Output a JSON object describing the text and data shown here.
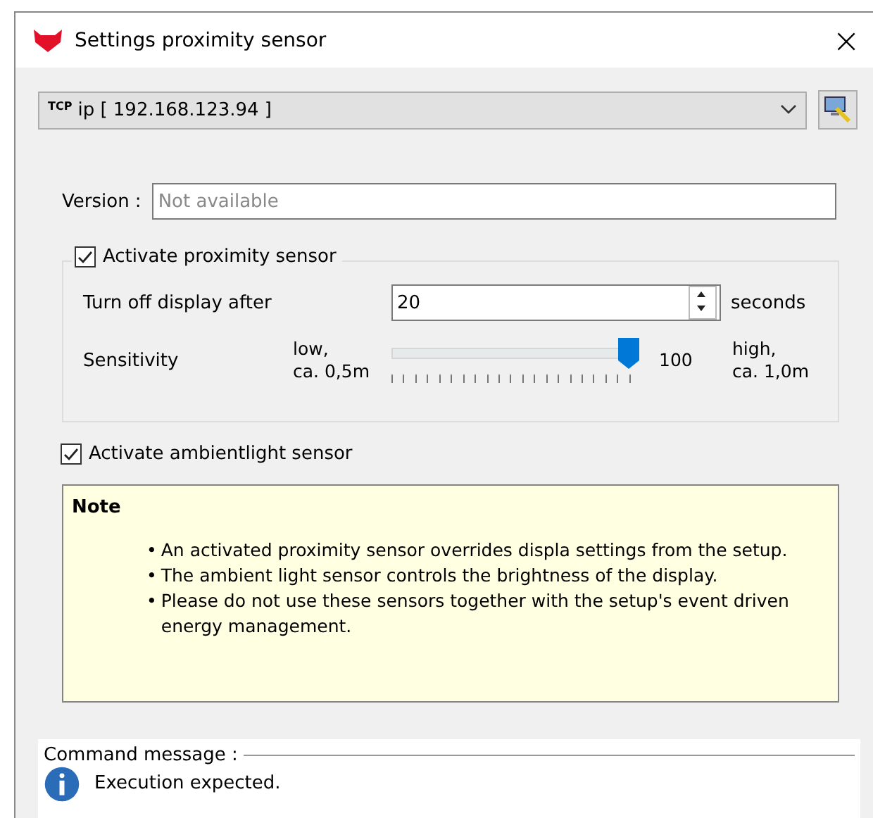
{
  "window": {
    "title": "Settings proximity sensor",
    "close": "×"
  },
  "connection": {
    "prefix": "TCP",
    "value": "ip [ 192.168.123.94 ]"
  },
  "version": {
    "label": "Version :",
    "placeholder": "Not available"
  },
  "proximity": {
    "label": "Activate proximity sensor",
    "checked": true,
    "turn_off": {
      "label": "Turn off display after",
      "value": "20",
      "unit": "seconds"
    },
    "sensitivity": {
      "label": "Sensitivity",
      "low": "low,\nca. 0,5m",
      "high": "high,\nca. 1,0m",
      "reading": "100",
      "level": 1
    }
  },
  "ambient": {
    "label": "Activate ambientlight sensor",
    "checked": true
  },
  "note": {
    "title": "Note",
    "items": [
      {
        "bullet": "•",
        "text": "An activated proximity sensor overrides displa settings from the setup."
      },
      {
        "bullet": "•",
        "text": "The ambient light sensor controls the brightness of the display."
      },
      {
        "bullet": "•",
        "text": "Please do not use these sensors together with the setup's event driven energy management."
      }
    ]
  },
  "command": {
    "label": "Command message :",
    "message": "Execution expected."
  }
}
